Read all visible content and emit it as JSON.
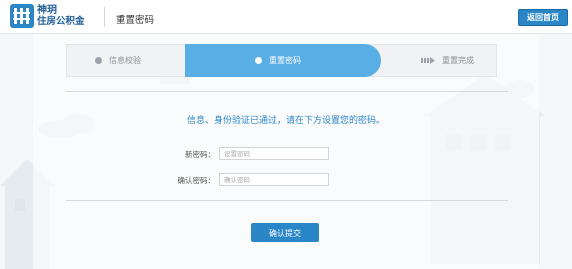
{
  "header": {
    "brand_line1": "神玥",
    "brand_line2": "住房公积金",
    "page_title": "重置密码",
    "home_button": "返回首页"
  },
  "steps": [
    {
      "label": "信息校验",
      "state": "done",
      "icon": "dot-icon"
    },
    {
      "label": "重置密码",
      "state": "active",
      "icon": "dot-icon"
    },
    {
      "label": "重置完成",
      "state": "pending",
      "icon": "arrow-right-icon"
    }
  ],
  "message": "信息、身份验证已通过，请在下方设置您的密码。",
  "form": {
    "new_password": {
      "label": "新密码：",
      "placeholder": "设置密码"
    },
    "confirm_password": {
      "label": "确认密码：",
      "placeholder": "确认密码"
    }
  },
  "submit_button": "确认提交",
  "colors": {
    "primary": "#2a86c7",
    "active_step": "#5aaee6",
    "background": "#f4f6f8"
  }
}
